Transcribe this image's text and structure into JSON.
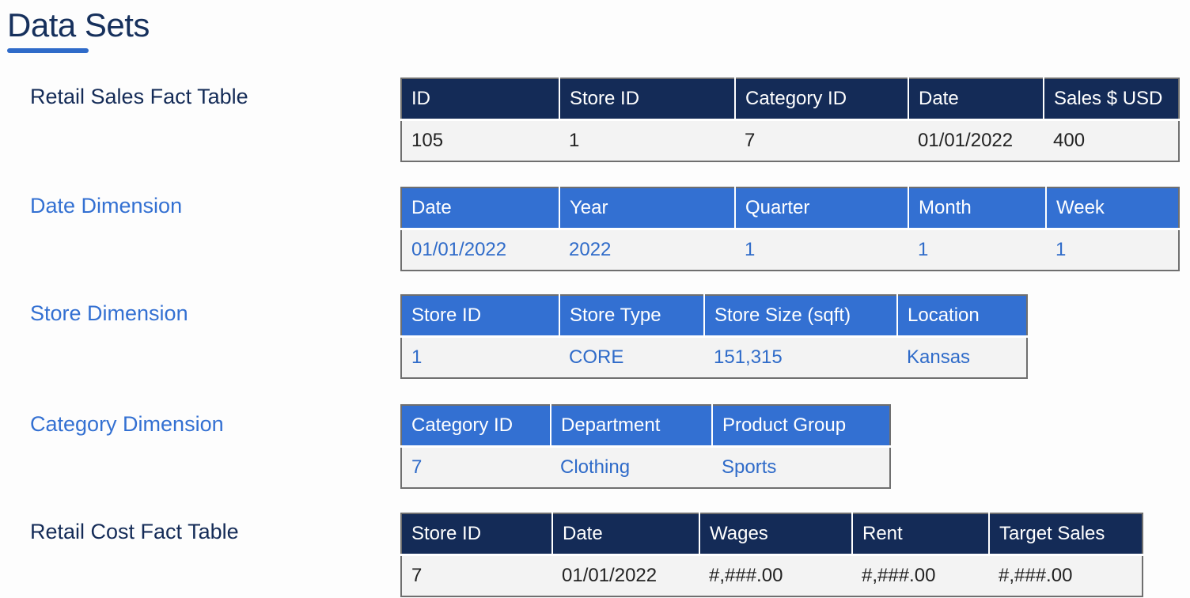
{
  "page": {
    "title": "Data Sets"
  },
  "datasets": [
    {
      "label": "Retail Sales Fact Table",
      "headers": [
        "ID",
        "Store ID",
        "Category ID",
        "Date",
        "Sales $ USD"
      ],
      "row": [
        "105",
        "1",
        "7",
        "01/01/2022",
        "400"
      ]
    },
    {
      "label": "Date Dimension",
      "headers": [
        "Date",
        "Year",
        "Quarter",
        "Month",
        "Week"
      ],
      "row": [
        "01/01/2022",
        "2022",
        "1",
        "1",
        "1"
      ]
    },
    {
      "label": "Store Dimension",
      "headers": [
        "Store ID",
        "Store Type",
        "Store Size (sqft)",
        "Location"
      ],
      "row": [
        "1",
        "CORE",
        "151,315",
        "Kansas"
      ]
    },
    {
      "label": "Category Dimension",
      "headers": [
        "Category ID",
        "Department",
        "Product Group"
      ],
      "row": [
        "7",
        "Clothing",
        "Sports"
      ]
    },
    {
      "label": "Retail Cost Fact Table",
      "headers": [
        "Store ID",
        "Date",
        "Wages",
        "Rent",
        "Target Sales"
      ],
      "row": [
        "7",
        "01/01/2022",
        "#,###.00",
        "#,###.00",
        "#,###.00"
      ]
    }
  ],
  "colors": {
    "navy": "#142b57",
    "blue": "#3370d2",
    "row_background": "#f3f3f3",
    "border": "#6f6f6f"
  }
}
